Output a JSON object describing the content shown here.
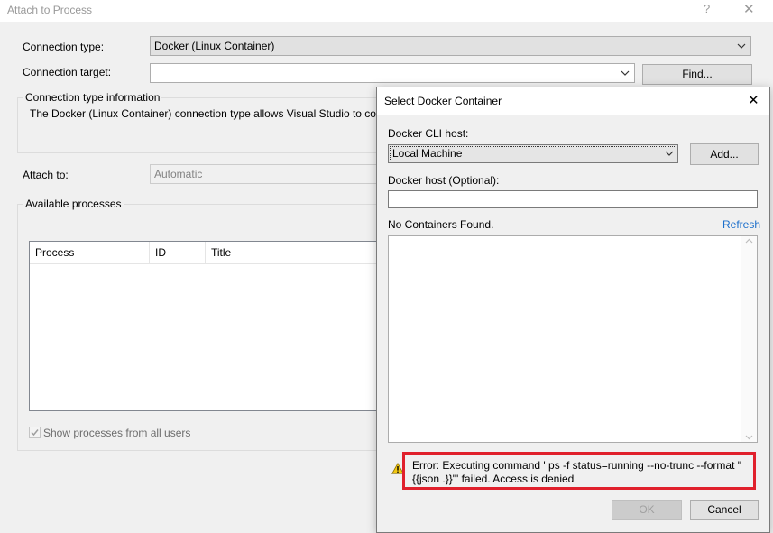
{
  "main": {
    "title": "Attach to Process",
    "help_glyph": "?",
    "close_glyph": "✕",
    "connection_type_label": "Connection type:",
    "connection_type_value": "Docker (Linux Container)",
    "connection_target_label": "Connection target:",
    "connection_target_value": "",
    "find_button": "Find...",
    "info_group_title": "Connection type information",
    "info_text": "The Docker (Linux Container) connection type allows Visual Studio to cor",
    "attach_to_label": "Attach to:",
    "attach_to_value": "Automatic",
    "processes_group_title": "Available processes",
    "columns": [
      "Process",
      "ID",
      "Title"
    ],
    "show_all_users_label": "Show processes from all users",
    "show_all_users_checked": true
  },
  "docker": {
    "title": "Select Docker Container",
    "close_glyph": "✕",
    "cli_host_label": "Docker CLI host:",
    "cli_host_value": "Local Machine",
    "add_button": "Add...",
    "docker_host_label": "Docker host (Optional):",
    "docker_host_value": "",
    "containers_status": "No Containers Found.",
    "refresh_link": "Refresh",
    "error_message": "Error: Executing command ' ps -f status=running --no-trunc --format \"{{json .}}\"' failed. Access is denied",
    "ok_button": "OK",
    "cancel_button": "Cancel"
  },
  "icons": {
    "chevron": "chevron-down-icon",
    "warning": "warning-icon",
    "close": "close-icon",
    "help": "help-icon",
    "check": "checkmark-icon"
  },
  "colors": {
    "error_border": "#e0202c",
    "link": "#1a6ecb",
    "focus_blue": "#0078d7",
    "warning_yellow": "#f2c811"
  }
}
